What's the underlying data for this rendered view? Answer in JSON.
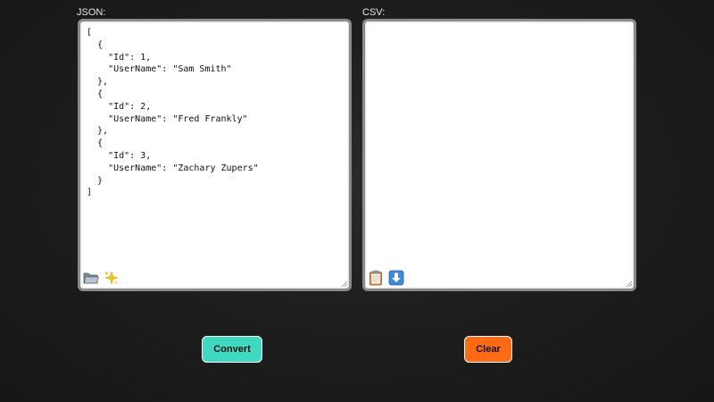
{
  "json_panel": {
    "label": "JSON:",
    "content": "[\n  {\n    \"Id\": 1,\n    \"UserName\": \"Sam Smith\"\n  },\n  {\n    \"Id\": 2,\n    \"UserName\": \"Fred Frankly\"\n  },\n  {\n    \"Id\": 3,\n    \"UserName\": \"Zachary Zupers\"\n  }\n]",
    "tools": [
      "folder-open-icon",
      "sparkles-icon"
    ]
  },
  "csv_panel": {
    "label": "CSV:",
    "content": "",
    "tools": [
      "clipboard-icon",
      "download-arrow-icon"
    ]
  },
  "buttons": {
    "convert_label": "Convert",
    "clear_label": "Clear"
  },
  "colors": {
    "convert": "#3fd8c0",
    "clear": "#ff6a14",
    "background": "#1e1e1e"
  }
}
